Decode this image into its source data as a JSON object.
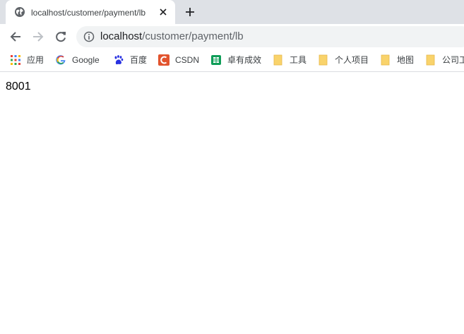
{
  "tab": {
    "title": "localhost/customer/payment/lb",
    "favicon": "globe-icon",
    "close_icon": "close-icon",
    "new_tab_icon": "plus-icon"
  },
  "toolbar": {
    "back_icon": "back-arrow-icon",
    "forward_icon": "forward-arrow-icon",
    "reload_icon": "reload-icon",
    "info_icon": "info-icon",
    "url_host": "localhost",
    "url_path": "/customer/payment/lb"
  },
  "bookmarks": [
    {
      "label": "应用",
      "icon": "apps-grid-icon"
    },
    {
      "label": "Google",
      "icon": "google-icon"
    },
    {
      "label": "百度",
      "icon": "baidu-icon"
    },
    {
      "label": "CSDN",
      "icon": "csdn-icon"
    },
    {
      "label": "卓有成效",
      "icon": "sheet-icon"
    },
    {
      "label": "工具",
      "icon": "folder-icon"
    },
    {
      "label": "个人项目",
      "icon": "folder-icon"
    },
    {
      "label": "地图",
      "icon": "folder-icon"
    },
    {
      "label": "公司工",
      "icon": "folder-icon"
    }
  ],
  "page": {
    "body_text": "8001"
  },
  "colors": {
    "tabstrip": "#dee1e6",
    "omnibox": "#f1f3f4",
    "csdn": "#e2542e",
    "sheet": "#0f9d58",
    "folder": "#f9d36b",
    "baidu": "#2932e1"
  }
}
